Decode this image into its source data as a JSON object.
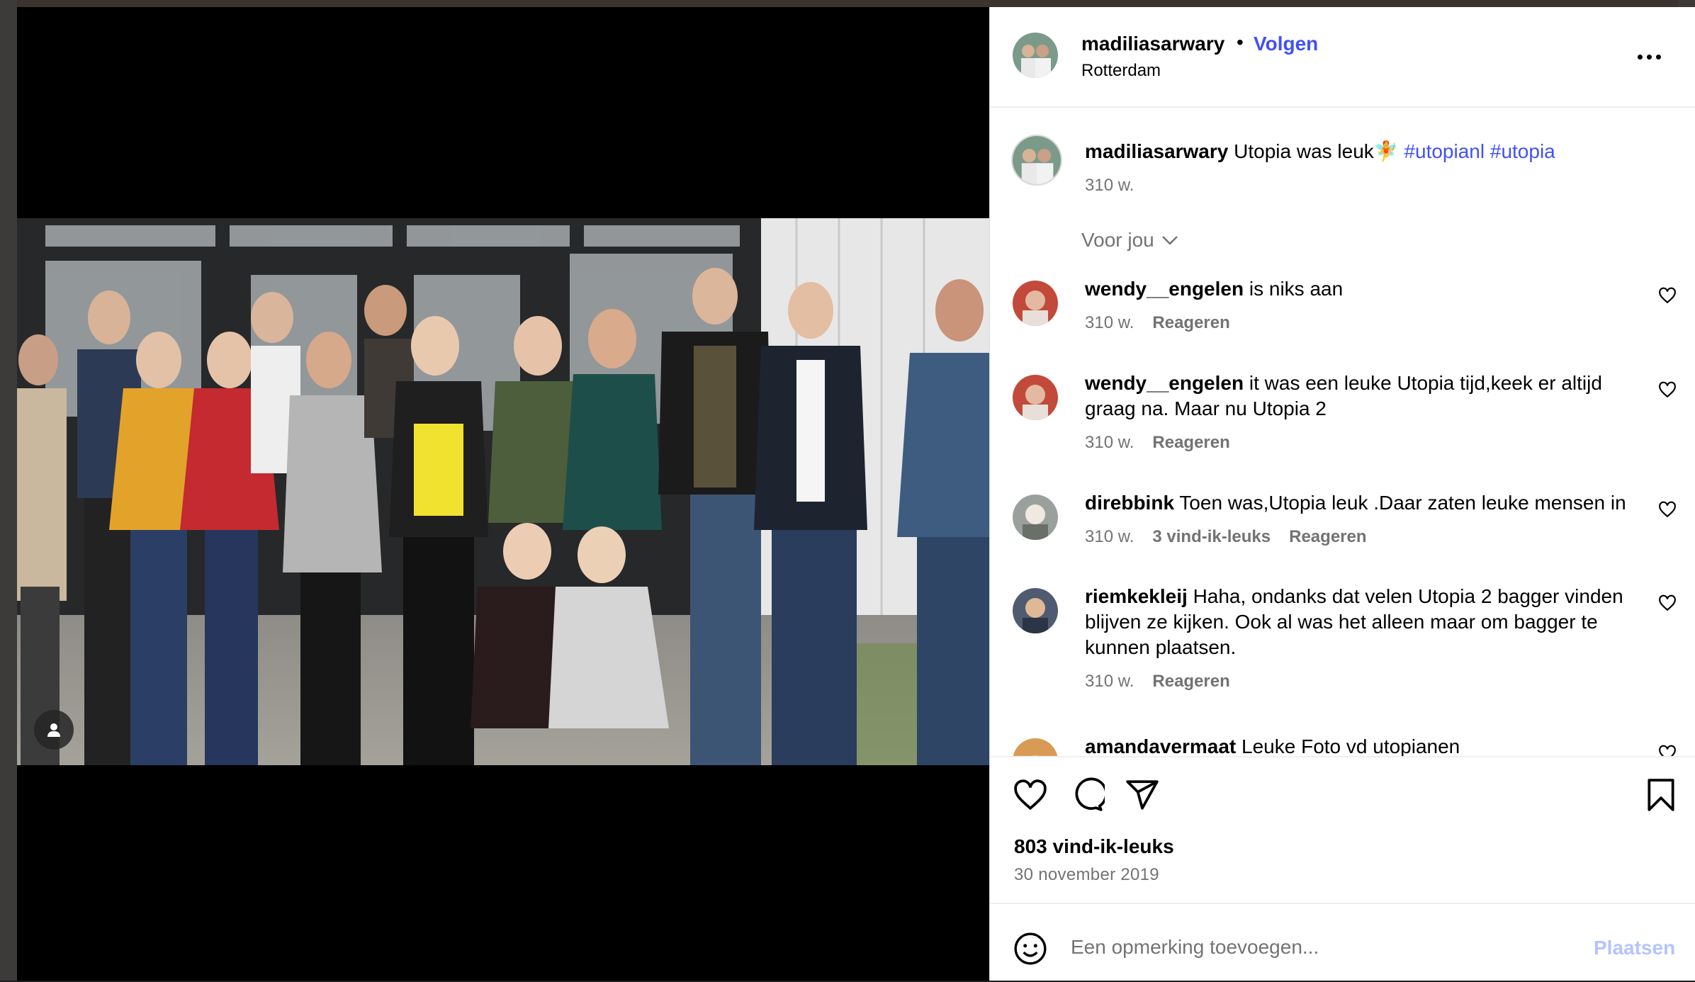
{
  "post": {
    "username": "madiliasarwary",
    "separator": "•",
    "follow_label": "Volgen",
    "location": "Rotterdam",
    "more_icon": "more-horizontal-icon",
    "caption": {
      "username": "madiliasarwary",
      "text": "Utopia was leuk",
      "emoji": "🧚",
      "hashtags": [
        "#utopianl",
        "#utopia"
      ],
      "time": "310 w."
    },
    "sort_label": "Voor jou",
    "likes": "803 vind-ik-leuks",
    "date": "30 november 2019"
  },
  "comments": [
    {
      "username": "wendy__engelen",
      "text": "is niks aan",
      "time": "310 w.",
      "likes": "",
      "reply_label": "Reageren"
    },
    {
      "username": "wendy__engelen",
      "text": "it was een leuke Utopia tijd,keek er altijd graag na. Maar nu Utopia 2",
      "time": "310 w.",
      "likes": "",
      "reply_label": "Reageren"
    },
    {
      "username": "direbbink",
      "text": "Toen was,Utopia leuk .Daar zaten leuke mensen in",
      "time": "310 w.",
      "likes": "3 vind-ik-leuks",
      "reply_label": "Reageren"
    },
    {
      "username": "riemkekleij",
      "text": "Haha, ondanks dat velen Utopia 2 bagger vinden blijven ze kijken. Ook al was het alleen maar om bagger te kunnen plaatsen.",
      "time": "310 w.",
      "likes": "",
      "reply_label": "Reageren"
    },
    {
      "username": "amandavermaat",
      "text": "Leuke Foto vd utopianen",
      "time": "",
      "likes": "",
      "reply_label": ""
    }
  ],
  "actions": {
    "icons": [
      "heart-icon",
      "comment-icon",
      "share-icon",
      "bookmark-icon"
    ]
  },
  "add_comment": {
    "placeholder": "Een opmerking toevoegen...",
    "post_label": "Plaatsen",
    "emoji_icon": "smiley-icon"
  },
  "colors": {
    "link_blue": "#4150f7",
    "muted": "#737373",
    "post_disabled": "#b3c4ff"
  }
}
